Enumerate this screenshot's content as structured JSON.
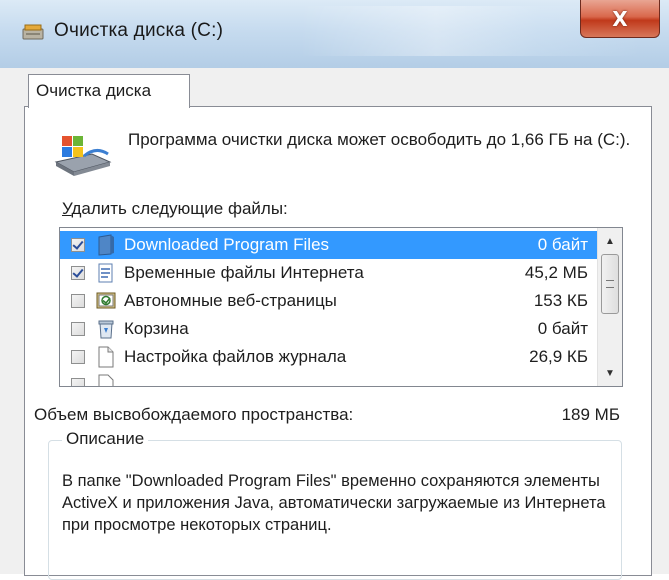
{
  "window": {
    "title": "Очистка диска  (C:)",
    "close_label": "X"
  },
  "tabs": [
    {
      "label": "Очистка диска",
      "selected": true
    }
  ],
  "header": {
    "text": "Программа очистки диска может освободить до 1,66 ГБ на  (C:)."
  },
  "files_section": {
    "label_accel": "У",
    "label_rest": "далить следующие файлы:",
    "items": [
      {
        "name": "Downloaded Program Files",
        "size": "0 байт",
        "checked": true,
        "selected": true,
        "icon": "folder-icon"
      },
      {
        "name": "Временные файлы Интернета",
        "size": "45,2 МБ",
        "checked": true,
        "selected": false,
        "icon": "document-icon"
      },
      {
        "name": "Автономные веб-страницы",
        "size": "153 КБ",
        "checked": false,
        "selected": false,
        "icon": "offline-pages-icon"
      },
      {
        "name": "Корзина",
        "size": "0 байт",
        "checked": false,
        "selected": false,
        "icon": "recycle-bin-icon"
      },
      {
        "name": "Настройка файлов журнала",
        "size": "26,9 КБ",
        "checked": false,
        "selected": false,
        "icon": "blank-file-icon"
      }
    ]
  },
  "space": {
    "label": "Объем высвобождаемого пространства:",
    "value": "189 МБ"
  },
  "description": {
    "title": "Описание",
    "text": "В папке \"Downloaded Program Files\" временно сохраняются элементы ActiveX и приложения Java, автоматически загружаемые из Интернета при просмотре некоторых страниц."
  },
  "colors": {
    "selection": "#3399ff",
    "close_button": "#c0391b",
    "titlebar": "#c6dbef"
  }
}
